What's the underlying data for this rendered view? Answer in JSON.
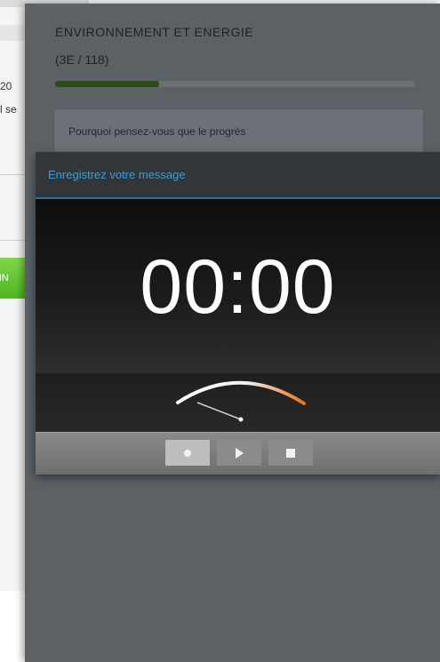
{
  "background": {
    "line1": "20",
    "line2": "l se",
    "green_button_label": "FIN"
  },
  "header": {
    "title": "ENVIRONNEMENT ET ENERGIE",
    "count": "(3E / 118)",
    "progress": 0.29
  },
  "question": {
    "text": "Pourquoi pensez-vous que le progrès"
  },
  "dialog": {
    "title": "Enregistrez votre message",
    "timer": "00:00",
    "controls": [
      {
        "name": "record",
        "icon": "record-dot-icon"
      },
      {
        "name": "play",
        "icon": "play-icon"
      },
      {
        "name": "stop",
        "icon": "stop-icon"
      }
    ]
  },
  "colors": {
    "accent_blue": "#3c9cd4",
    "meter_orange": "#e8731c",
    "progress_green": "#2c4d12"
  }
}
